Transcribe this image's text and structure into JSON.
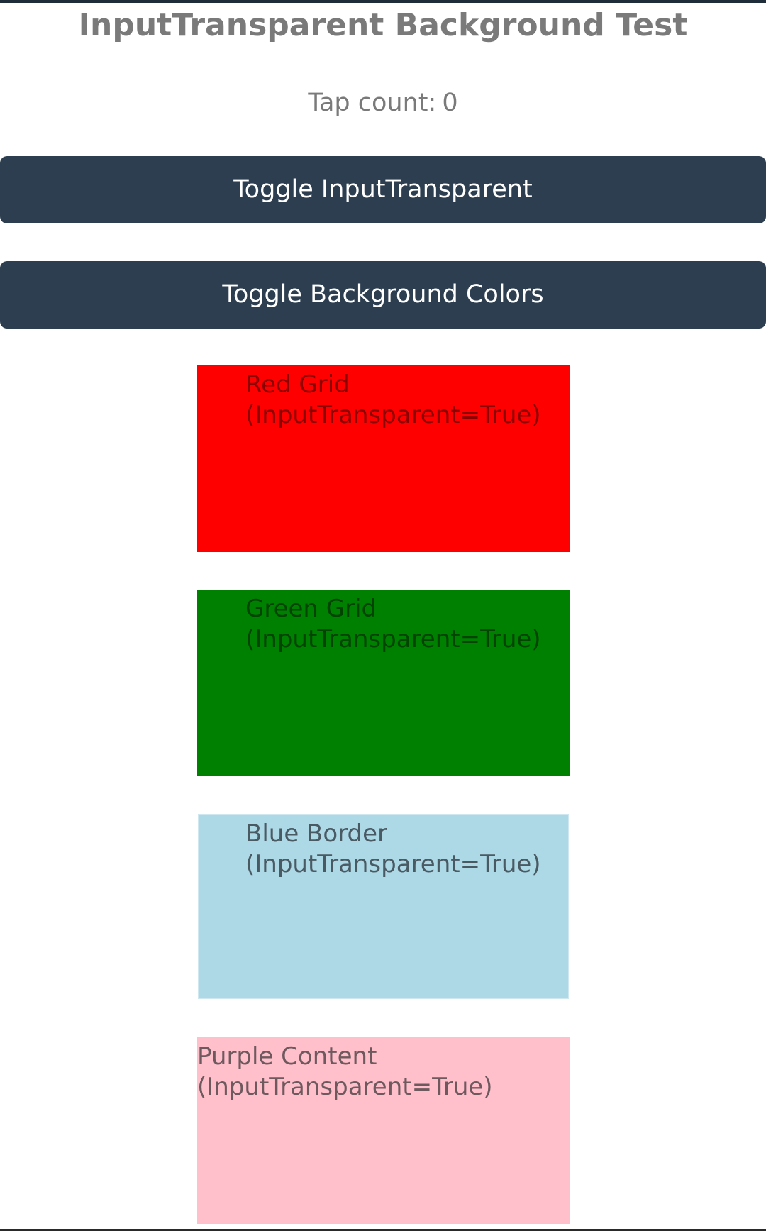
{
  "page": {
    "title": "InputTransparent Background Test"
  },
  "counter": {
    "label": "Tap count:",
    "value": "0"
  },
  "buttons": {
    "toggle_input_transparent": "Toggle InputTransparent",
    "toggle_background_colors": "Toggle Background Colors"
  },
  "boxes": {
    "red": {
      "line1": "Red Grid",
      "line2": "(InputTransparent=True)",
      "color": "#ff0000"
    },
    "green": {
      "line1": "Green Grid",
      "line2": "(InputTransparent=True)",
      "color": "#008000"
    },
    "blue": {
      "line1": "Blue Border",
      "line2": "(InputTransparent=True)",
      "color": "#add8e6"
    },
    "purple": {
      "line1": "Purple Content",
      "line2": "(InputTransparent=True)",
      "color": "#ffc0cb"
    }
  },
  "colors": {
    "button_bg": "#2c3e50",
    "button_text": "#ffffff",
    "title_text": "#7a7a7a"
  }
}
